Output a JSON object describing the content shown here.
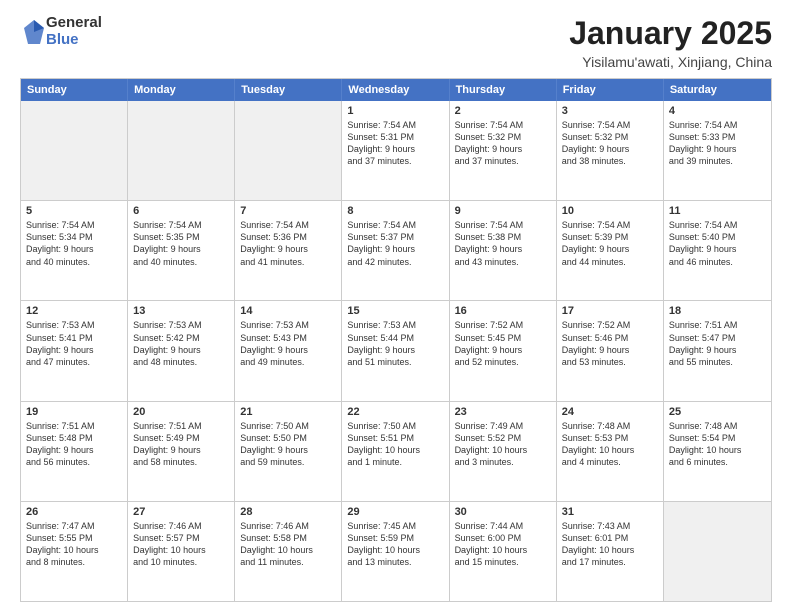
{
  "logo": {
    "general": "General",
    "blue": "Blue"
  },
  "header": {
    "month": "January 2025",
    "location": "Yisilamu'awati, Xinjiang, China"
  },
  "weekdays": [
    "Sunday",
    "Monday",
    "Tuesday",
    "Wednesday",
    "Thursday",
    "Friday",
    "Saturday"
  ],
  "weeks": [
    [
      {
        "day": "",
        "info": "",
        "shade": true
      },
      {
        "day": "",
        "info": "",
        "shade": true
      },
      {
        "day": "",
        "info": "",
        "shade": true
      },
      {
        "day": "1",
        "info": "Sunrise: 7:54 AM\nSunset: 5:31 PM\nDaylight: 9 hours\nand 37 minutes."
      },
      {
        "day": "2",
        "info": "Sunrise: 7:54 AM\nSunset: 5:32 PM\nDaylight: 9 hours\nand 37 minutes."
      },
      {
        "day": "3",
        "info": "Sunrise: 7:54 AM\nSunset: 5:32 PM\nDaylight: 9 hours\nand 38 minutes."
      },
      {
        "day": "4",
        "info": "Sunrise: 7:54 AM\nSunset: 5:33 PM\nDaylight: 9 hours\nand 39 minutes."
      }
    ],
    [
      {
        "day": "5",
        "info": "Sunrise: 7:54 AM\nSunset: 5:34 PM\nDaylight: 9 hours\nand 40 minutes."
      },
      {
        "day": "6",
        "info": "Sunrise: 7:54 AM\nSunset: 5:35 PM\nDaylight: 9 hours\nand 40 minutes."
      },
      {
        "day": "7",
        "info": "Sunrise: 7:54 AM\nSunset: 5:36 PM\nDaylight: 9 hours\nand 41 minutes."
      },
      {
        "day": "8",
        "info": "Sunrise: 7:54 AM\nSunset: 5:37 PM\nDaylight: 9 hours\nand 42 minutes."
      },
      {
        "day": "9",
        "info": "Sunrise: 7:54 AM\nSunset: 5:38 PM\nDaylight: 9 hours\nand 43 minutes."
      },
      {
        "day": "10",
        "info": "Sunrise: 7:54 AM\nSunset: 5:39 PM\nDaylight: 9 hours\nand 44 minutes."
      },
      {
        "day": "11",
        "info": "Sunrise: 7:54 AM\nSunset: 5:40 PM\nDaylight: 9 hours\nand 46 minutes."
      }
    ],
    [
      {
        "day": "12",
        "info": "Sunrise: 7:53 AM\nSunset: 5:41 PM\nDaylight: 9 hours\nand 47 minutes."
      },
      {
        "day": "13",
        "info": "Sunrise: 7:53 AM\nSunset: 5:42 PM\nDaylight: 9 hours\nand 48 minutes."
      },
      {
        "day": "14",
        "info": "Sunrise: 7:53 AM\nSunset: 5:43 PM\nDaylight: 9 hours\nand 49 minutes."
      },
      {
        "day": "15",
        "info": "Sunrise: 7:53 AM\nSunset: 5:44 PM\nDaylight: 9 hours\nand 51 minutes."
      },
      {
        "day": "16",
        "info": "Sunrise: 7:52 AM\nSunset: 5:45 PM\nDaylight: 9 hours\nand 52 minutes."
      },
      {
        "day": "17",
        "info": "Sunrise: 7:52 AM\nSunset: 5:46 PM\nDaylight: 9 hours\nand 53 minutes."
      },
      {
        "day": "18",
        "info": "Sunrise: 7:51 AM\nSunset: 5:47 PM\nDaylight: 9 hours\nand 55 minutes."
      }
    ],
    [
      {
        "day": "19",
        "info": "Sunrise: 7:51 AM\nSunset: 5:48 PM\nDaylight: 9 hours\nand 56 minutes."
      },
      {
        "day": "20",
        "info": "Sunrise: 7:51 AM\nSunset: 5:49 PM\nDaylight: 9 hours\nand 58 minutes."
      },
      {
        "day": "21",
        "info": "Sunrise: 7:50 AM\nSunset: 5:50 PM\nDaylight: 9 hours\nand 59 minutes."
      },
      {
        "day": "22",
        "info": "Sunrise: 7:50 AM\nSunset: 5:51 PM\nDaylight: 10 hours\nand 1 minute."
      },
      {
        "day": "23",
        "info": "Sunrise: 7:49 AM\nSunset: 5:52 PM\nDaylight: 10 hours\nand 3 minutes."
      },
      {
        "day": "24",
        "info": "Sunrise: 7:48 AM\nSunset: 5:53 PM\nDaylight: 10 hours\nand 4 minutes."
      },
      {
        "day": "25",
        "info": "Sunrise: 7:48 AM\nSunset: 5:54 PM\nDaylight: 10 hours\nand 6 minutes."
      }
    ],
    [
      {
        "day": "26",
        "info": "Sunrise: 7:47 AM\nSunset: 5:55 PM\nDaylight: 10 hours\nand 8 minutes."
      },
      {
        "day": "27",
        "info": "Sunrise: 7:46 AM\nSunset: 5:57 PM\nDaylight: 10 hours\nand 10 minutes."
      },
      {
        "day": "28",
        "info": "Sunrise: 7:46 AM\nSunset: 5:58 PM\nDaylight: 10 hours\nand 11 minutes."
      },
      {
        "day": "29",
        "info": "Sunrise: 7:45 AM\nSunset: 5:59 PM\nDaylight: 10 hours\nand 13 minutes."
      },
      {
        "day": "30",
        "info": "Sunrise: 7:44 AM\nSunset: 6:00 PM\nDaylight: 10 hours\nand 15 minutes."
      },
      {
        "day": "31",
        "info": "Sunrise: 7:43 AM\nSunset: 6:01 PM\nDaylight: 10 hours\nand 17 minutes."
      },
      {
        "day": "",
        "info": "",
        "shade": true
      }
    ]
  ]
}
